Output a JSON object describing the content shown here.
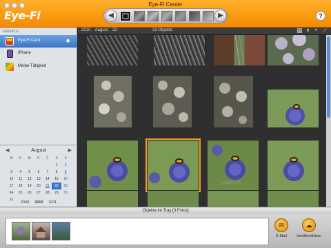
{
  "window": {
    "title": "Eye-Fi Center"
  },
  "brand": {
    "logo_text": "Eye-Fi",
    "accent": "#f58a00"
  },
  "nav": {
    "back_icon": "back-arrow-icon",
    "forward_icon": "forward-arrow-icon"
  },
  "sidebar": {
    "header": "GERÄTE",
    "devices": [
      {
        "label": "Eye-Fi Card",
        "icon": "eyefi-card-icon",
        "selected": true
      },
      {
        "label": "iPhone",
        "icon": "iphone-icon",
        "selected": false
      },
      {
        "label": "Meine Tätigkeit",
        "icon": "activity-icon",
        "selected": false
      }
    ]
  },
  "calendar": {
    "month": "August",
    "weekdays": [
      "M",
      "D",
      "M",
      "D",
      "F",
      "S",
      "S"
    ],
    "weeks": [
      [
        "",
        "",
        "",
        "",
        "",
        "1",
        "2"
      ],
      [
        "3",
        "4",
        "5",
        "6",
        "7",
        "8",
        "9"
      ],
      [
        "10",
        "11",
        "12",
        "13",
        "14",
        "15",
        "16"
      ],
      [
        "17",
        "18",
        "19",
        "20",
        "21",
        "22",
        "23"
      ],
      [
        "24",
        "25",
        "26",
        "27",
        "28",
        "29",
        "30"
      ],
      [
        "31",
        "",
        "",
        "",
        "",
        "",
        ""
      ]
    ],
    "years": [
      "2009",
      "2010",
      "2011"
    ]
  },
  "grid_header": {
    "year": "2010",
    "month": "August",
    "day": "22",
    "count": "33 Objekte"
  },
  "photos": [
    {
      "caption": ""
    },
    {
      "caption": ""
    },
    {
      "caption": ""
    },
    {
      "caption": ""
    },
    {
      "caption": ""
    },
    {
      "caption": ""
    },
    {
      "caption": ""
    },
    {
      "caption": ""
    },
    {
      "caption": ""
    },
    {
      "caption": ""
    },
    {
      "caption": "_MG5926.JPG"
    },
    {
      "caption": ""
    },
    {
      "caption": ""
    },
    {
      "caption": ""
    },
    {
      "caption": ""
    },
    {
      "caption": ""
    }
  ],
  "tray": {
    "title": "Objekte im Tray [3 Fotos]",
    "email_label": "E-Mail",
    "publish_label": "Veröffentlichen"
  }
}
